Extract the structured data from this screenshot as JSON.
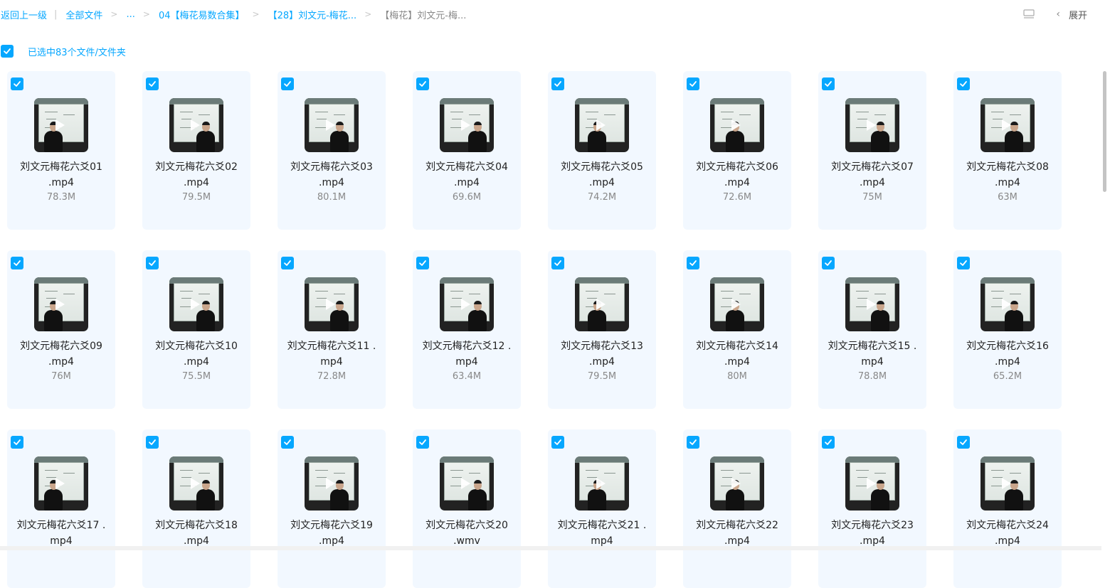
{
  "breadcrumb": {
    "back": "返回上一级",
    "all_files": "全部文件",
    "ellipsis": "...",
    "level1": "04【梅花易数合集】",
    "level2": "【28】刘文元-梅花...",
    "current": "【梅花】刘文元-梅..."
  },
  "toolbar": {
    "expand_label": "展开",
    "view_icon": "list-view-icon",
    "chevron_icon": "chevron-left-icon"
  },
  "selection": {
    "label": "已选中83个文件/文件夹"
  },
  "colors": {
    "accent": "#06a7ff",
    "card_bg": "#f2f8ff"
  },
  "files": [
    {
      "line1": "刘文元梅花六爻01",
      "line2": ".mp4",
      "size": "78.3M"
    },
    {
      "line1": "刘文元梅花六爻02",
      "line2": ".mp4",
      "size": "79.5M"
    },
    {
      "line1": "刘文元梅花六爻03",
      "line2": ".mp4",
      "size": "80.1M"
    },
    {
      "line1": "刘文元梅花六爻04",
      "line2": ".mp4",
      "size": "69.6M"
    },
    {
      "line1": "刘文元梅花六爻05",
      "line2": ".mp4",
      "size": "74.2M"
    },
    {
      "line1": "刘文元梅花六爻06",
      "line2": ".mp4",
      "size": "72.6M"
    },
    {
      "line1": "刘文元梅花六爻07",
      "line2": ".mp4",
      "size": "75M"
    },
    {
      "line1": "刘文元梅花六爻08",
      "line2": ".mp4",
      "size": "63M"
    },
    {
      "line1": "刘文元梅花六爻09",
      "line2": ".mp4",
      "size": "76M"
    },
    {
      "line1": "刘文元梅花六爻10",
      "line2": ".mp4",
      "size": "75.5M"
    },
    {
      "line1": "刘文元梅花六爻11 .",
      "line2": "mp4",
      "size": "72.8M"
    },
    {
      "line1": "刘文元梅花六爻12 .",
      "line2": "mp4",
      "size": "63.4M"
    },
    {
      "line1": "刘文元梅花六爻13",
      "line2": ".mp4",
      "size": "79.5M"
    },
    {
      "line1": "刘文元梅花六爻14",
      "line2": ".mp4",
      "size": "80M"
    },
    {
      "line1": "刘文元梅花六爻15 .",
      "line2": "mp4",
      "size": "78.8M"
    },
    {
      "line1": "刘文元梅花六爻16",
      "line2": ".mp4",
      "size": "65.2M"
    },
    {
      "line1": "刘文元梅花六爻17 .",
      "line2": "mp4",
      "size": ""
    },
    {
      "line1": "刘文元梅花六爻18",
      "line2": ".mp4",
      "size": ""
    },
    {
      "line1": "刘文元梅花六爻19",
      "line2": ".mp4",
      "size": ""
    },
    {
      "line1": "刘文元梅花六爻20",
      "line2": ".wmv",
      "size": ""
    },
    {
      "line1": "刘文元梅花六爻21 .",
      "line2": "mp4",
      "size": ""
    },
    {
      "line1": "刘文元梅花六爻22",
      "line2": ".mp4",
      "size": ""
    },
    {
      "line1": "刘文元梅花六爻23",
      "line2": ".mp4",
      "size": ""
    },
    {
      "line1": "刘文元梅花六爻24",
      "line2": ".mp4",
      "size": ""
    }
  ]
}
